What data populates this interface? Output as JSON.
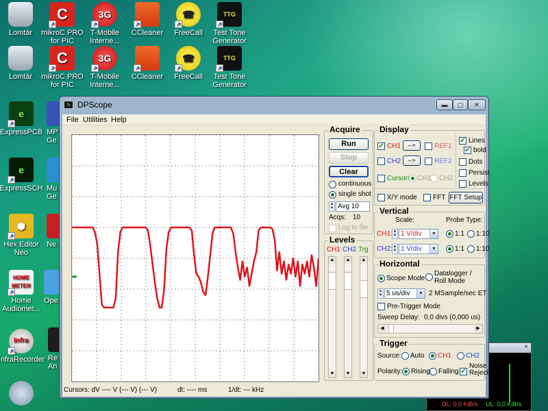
{
  "desktop": {
    "row1": [
      {
        "label": "Lomtár",
        "icon": "recycle-bin-icon"
      },
      {
        "label": "mikroC PRO for PIC",
        "icon": "mikroc-icon",
        "glyph": "C"
      },
      {
        "label": "T-Mobile Interne...",
        "icon": "tmobile-icon",
        "glyph": "3G"
      },
      {
        "label": "CCleaner",
        "icon": "ccleaner-icon"
      },
      {
        "label": "FreeCall",
        "icon": "phone-icon",
        "glyph": "☎"
      },
      {
        "label": "Test Tone Generator",
        "icon": "tone-generator-icon",
        "glyph": "TTG"
      }
    ],
    "row2": [
      {
        "label": "Lomtár",
        "icon": "recycle-bin-icon"
      },
      {
        "label": "mikroC PRO for PIC",
        "icon": "mikroc-icon",
        "glyph": "C"
      },
      {
        "label": "T-Mobile Interne...",
        "icon": "tmobile-icon",
        "glyph": "3G"
      },
      {
        "label": "CCleaner",
        "icon": "ccleaner-icon"
      },
      {
        "label": "FreeCall",
        "icon": "phone-icon",
        "glyph": "☎"
      },
      {
        "label": "Test Tone Generator",
        "icon": "tone-generator-icon",
        "glyph": "TTG"
      }
    ],
    "col": [
      {
        "label": "ExpressPCB",
        "icon": "expresspcb-icon",
        "glyph": "e"
      },
      {
        "label": "ExpressSCH",
        "icon": "expresssch-icon",
        "glyph": "e"
      },
      {
        "label": "Hex Editor Neo",
        "icon": "hex-editor-icon",
        "glyph": "⬢"
      },
      {
        "label": "Home Audiomet...",
        "icon": "audiometer-icon",
        "glyph": "HOME METER"
      },
      {
        "label": "InfraRecorder",
        "icon": "infrarecorder-icon",
        "glyph": "Infra"
      },
      {
        "label": "",
        "icon": "webcam-icon",
        "glyph": ""
      }
    ],
    "col2": [
      {
        "label": "MP Ge"
      },
      {
        "label": "Mu Ge"
      },
      {
        "label": "Ne"
      },
      {
        "label": "Ope"
      },
      {
        "label": "Re An"
      }
    ],
    "widget": {
      "dl": "DL: 0,0 KiB/s",
      "ul": "UL: 0,0 KiB/s"
    }
  },
  "window": {
    "title": "DPScope",
    "menu": [
      "File",
      "Utilities",
      "Help"
    ]
  },
  "acquire": {
    "title": "Acquire",
    "run": "Run",
    "stop": "Stop",
    "clear": "Clear",
    "continuous": "continuous",
    "single_shot": "single shot",
    "avg": "Avg 10",
    "acqs_label": "Acqs:",
    "acqs_value": "10",
    "log_to_file": "Log to file"
  },
  "levels": {
    "title": "Levels",
    "ch1": "CH1",
    "ch2": "CH2",
    "trg": "Trg"
  },
  "display": {
    "title": "Display",
    "ch1": "CH1",
    "ch2": "CH2",
    "arrow": "-->",
    "ref1": "REF1",
    "ref2": "REF2",
    "cursors": "Cursors",
    "cur_ch1": "CH1",
    "cur_ch2": "CH2",
    "lines": "Lines",
    "bold": "bold",
    "dots": "Dots",
    "persist": "Persist",
    "levels": "Levels",
    "xy_mode": "X/Y mode",
    "fft": "FFT",
    "fft_setup": "FFT Setup"
  },
  "vertical": {
    "title": "Vertical",
    "scale": "Scale:",
    "probe_type": "Probe Type:",
    "ch1": "CH1:",
    "ch2": "CH2:",
    "ch1_scale": "1 V/div",
    "ch2_scale": "1 V/div",
    "p11": "1:1",
    "p110": "1:10"
  },
  "horizontal": {
    "title": "Horizontal",
    "scope_mode": "Scope Mode",
    "datalogger": "Datalogger / Roll Mode",
    "timebase": "5 us/div",
    "rate": "2 MSample/sec ET",
    "pretrigger": "Pre-Trigger Mode",
    "sweep_delay_label": "Sweep Delay:",
    "sweep_delay_value": "0,0 divs (0,000 us)"
  },
  "trigger": {
    "title": "Trigger",
    "source": "Source:",
    "auto": "Auto",
    "ch1": "CH1",
    "ch2": "CH2",
    "polarity": "Polarity:",
    "rising": "Rising",
    "falling": "Falling",
    "noise_reject": "Noise Reject"
  },
  "status": {
    "cursors": "Cursors:  dV  ---- V   (--- V)  (--- V)",
    "dt": "dt:  ---- ms",
    "freq": "1/dt:  --- kHz"
  },
  "chart_data": {
    "type": "line",
    "series": [
      {
        "color": "#e0141b",
        "values": [
          1,
          1,
          1,
          1,
          1,
          1,
          1,
          1,
          1,
          1,
          0.85,
          0.45,
          -0.55,
          -1.5,
          -1.6,
          -1.6,
          -1.6,
          -1.6,
          -1.6,
          -1.3,
          0.2,
          0.85,
          1,
          1,
          1,
          1,
          1,
          1,
          1,
          1,
          1,
          1,
          1,
          0.9,
          0.4,
          -0.2,
          -0.8,
          -1.3,
          -1.6,
          -1.6,
          -1.0,
          0.3,
          0.85,
          1,
          1,
          1,
          1,
          1,
          1,
          1,
          1,
          1,
          0.9,
          0.1,
          -0.5,
          -0.6,
          -0.8,
          -1.1,
          -1.2,
          -0.6,
          0.1,
          0.8,
          1,
          1,
          1,
          1,
          1,
          1,
          1,
          1,
          0.8,
          0.2,
          -0.3,
          -0.7,
          -0.1,
          -0.6,
          -0.3,
          -0.9,
          -0.5,
          -0.1,
          0.2,
          0.9,
          1,
          1,
          1,
          1,
          1,
          0.95,
          0.6,
          -0.4,
          0.2,
          -0.5,
          -0.1,
          -0.7,
          -0.2,
          -0.5,
          0.0,
          -0.6,
          -0.1,
          -0.9,
          -0.2,
          -0.5,
          -0.1,
          -0.6,
          0.1,
          -0.3,
          -0.9,
          0.0
        ]
      }
    ],
    "ylim": [
      -4,
      4
    ],
    "xdivs": 10,
    "ydivs": 8,
    "grid": true,
    "ch1_marker_level": -0.6,
    "ch1_marker_color": "#1f9a2a"
  }
}
